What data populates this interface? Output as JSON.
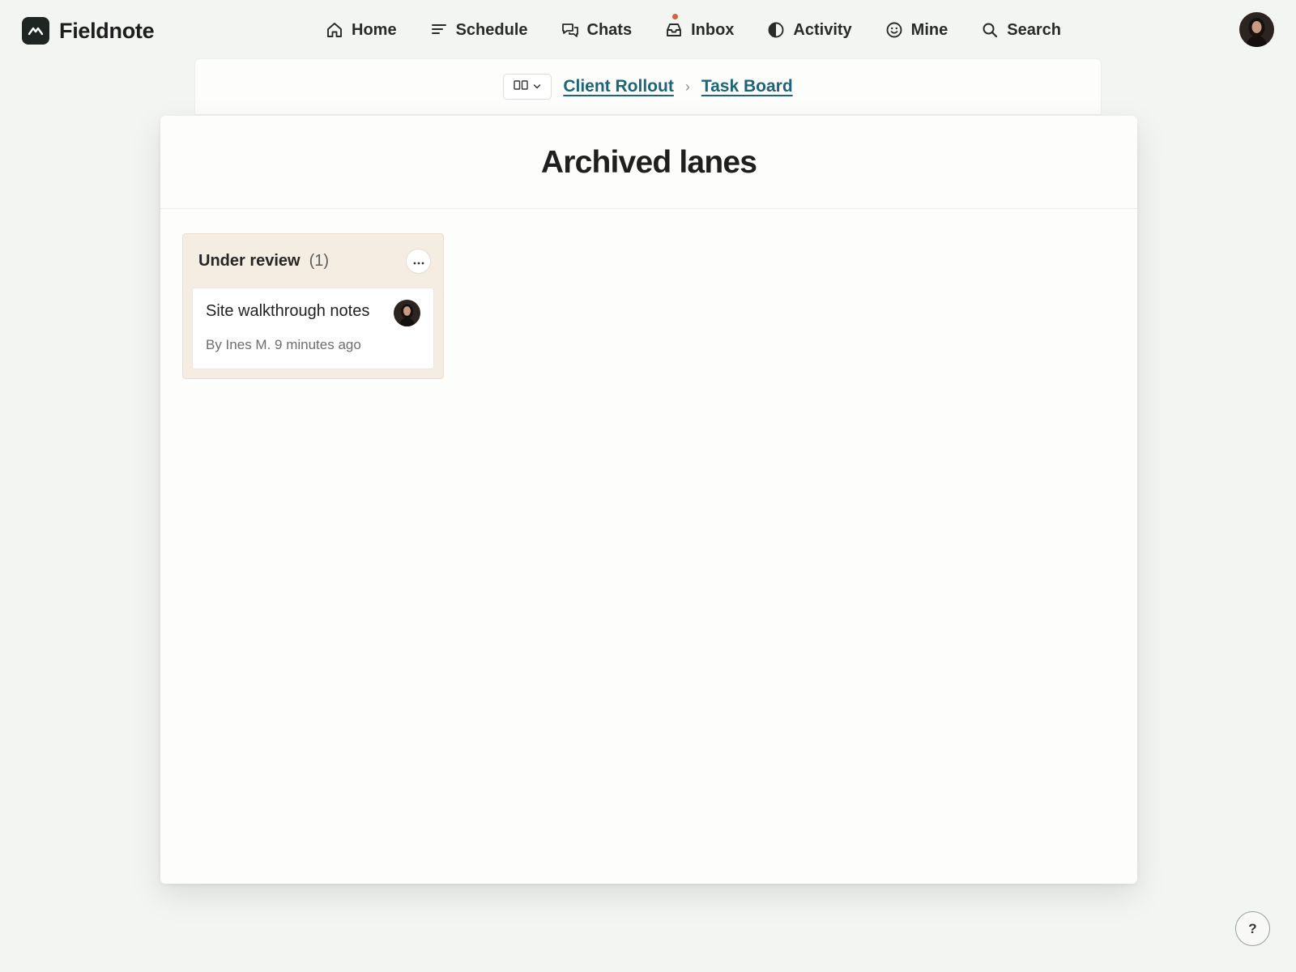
{
  "app": {
    "name": "Fieldnote"
  },
  "nav": {
    "items": [
      {
        "label": "Home",
        "icon": "home-icon"
      },
      {
        "label": "Schedule",
        "icon": "lines-icon"
      },
      {
        "label": "Chats",
        "icon": "chat-bubbles-icon"
      },
      {
        "label": "Inbox",
        "icon": "inbox-tray-icon",
        "has_notification": true
      },
      {
        "label": "Activity",
        "icon": "half-circle-icon"
      },
      {
        "label": "Mine",
        "icon": "smiley-icon"
      },
      {
        "label": "Search",
        "icon": "search-icon"
      }
    ]
  },
  "breadcrumb": {
    "view_switch_icon": "columns-icon",
    "project": "Client Rollout",
    "separator": "›",
    "board": "Task Board"
  },
  "page": {
    "title": "Archived lanes"
  },
  "lanes": [
    {
      "title": "Under review",
      "count": "(1)",
      "menu_label": "···",
      "cards": [
        {
          "title": "Site walkthrough notes",
          "meta": "By Ines M. 9 minutes ago"
        }
      ]
    }
  ],
  "help": {
    "label": "?"
  },
  "colors": {
    "accent_link": "#1e6479",
    "notification_dot": "#d2633f",
    "lane_background": "#f6ede2",
    "page_background": "#f3f5f3"
  }
}
